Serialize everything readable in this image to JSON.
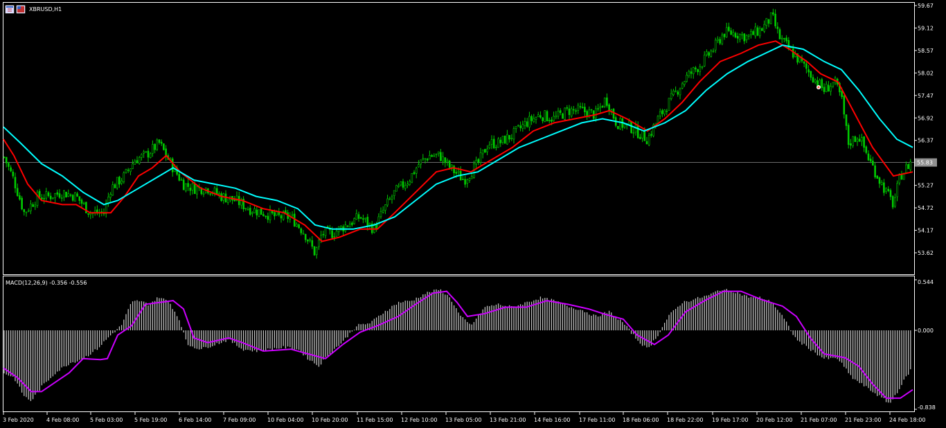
{
  "window": {
    "title": "XBRUSD,H1",
    "icon_names": [
      "chart-window-icon",
      "symbol-flag-icon"
    ]
  },
  "chart_data": [
    {
      "type": "candlestick",
      "symbol": "XBRUSD",
      "timeframe": "H1",
      "ylim": [
        53.3,
        59.7
      ],
      "y_ticks": [
        "59.67",
        "59.12",
        "58.57",
        "58.02",
        "57.47",
        "56.92",
        "56.37",
        "55.83",
        "55.27",
        "54.72",
        "54.17",
        "53.62"
      ],
      "current_price": "55.83",
      "x_ticks": [
        "3 Feb 2020",
        "4 Feb 08:00",
        "5 Feb 03:00",
        "5 Feb 19:00",
        "6 Feb 14:00",
        "7 Feb 09:00",
        "10 Feb 04:00",
        "10 Feb 20:00",
        "11 Feb 15:00",
        "12 Feb 10:00",
        "13 Feb 05:00",
        "13 Feb 21:00",
        "14 Feb 16:00",
        "17 Feb 11:00",
        "18 Feb 06:00",
        "18 Feb 22:00",
        "19 Feb 17:00",
        "20 Feb 12:00",
        "21 Feb 07:00",
        "21 Feb 23:00",
        "24 Feb 18:00"
      ],
      "close_path": [
        [
          0,
          56.2
        ],
        [
          20,
          55.4
        ],
        [
          35,
          54.6
        ],
        [
          55,
          55.0
        ],
        [
          70,
          55.0
        ],
        [
          90,
          55.1
        ],
        [
          110,
          55.0
        ],
        [
          130,
          54.6
        ],
        [
          150,
          54.6
        ],
        [
          160,
          55.2
        ],
        [
          180,
          55.5
        ],
        [
          195,
          55.9
        ],
        [
          210,
          56.0
        ],
        [
          230,
          56.3
        ],
        [
          250,
          55.7
        ],
        [
          265,
          55.3
        ],
        [
          280,
          55.2
        ],
        [
          300,
          55.2
        ],
        [
          320,
          55.0
        ],
        [
          340,
          54.9
        ],
        [
          360,
          54.7
        ],
        [
          380,
          54.6
        ],
        [
          400,
          54.5
        ],
        [
          420,
          54.5
        ],
        [
          440,
          54.1
        ],
        [
          455,
          53.6
        ],
        [
          465,
          54.1
        ],
        [
          480,
          54.1
        ],
        [
          500,
          54.3
        ],
        [
          520,
          54.5
        ],
        [
          540,
          54.2
        ],
        [
          555,
          54.7
        ],
        [
          570,
          55.1
        ],
        [
          590,
          55.4
        ],
        [
          605,
          55.8
        ],
        [
          620,
          56.0
        ],
        [
          635,
          56.0
        ],
        [
          650,
          55.7
        ],
        [
          670,
          55.4
        ],
        [
          690,
          55.8
        ],
        [
          705,
          56.3
        ],
        [
          720,
          56.3
        ],
        [
          740,
          56.5
        ],
        [
          760,
          56.8
        ],
        [
          780,
          57.0
        ],
        [
          800,
          56.9
        ],
        [
          820,
          57.1
        ],
        [
          840,
          57.1
        ],
        [
          860,
          57.0
        ],
        [
          875,
          57.4
        ],
        [
          890,
          56.8
        ],
        [
          910,
          56.7
        ],
        [
          935,
          56.4
        ],
        [
          950,
          56.9
        ],
        [
          970,
          57.4
        ],
        [
          990,
          57.9
        ],
        [
          1010,
          58.2
        ],
        [
          1030,
          58.6
        ],
        [
          1045,
          59.0
        ],
        [
          1060,
          59.0
        ],
        [
          1080,
          58.9
        ],
        [
          1100,
          59.1
        ],
        [
          1115,
          59.4
        ],
        [
          1125,
          58.9
        ],
        [
          1140,
          58.6
        ],
        [
          1160,
          58.2
        ],
        [
          1175,
          57.9
        ],
        [
          1190,
          57.6
        ],
        [
          1205,
          57.8
        ],
        [
          1215,
          57.4
        ],
        [
          1225,
          56.3
        ],
        [
          1240,
          56.5
        ],
        [
          1255,
          55.9
        ],
        [
          1270,
          55.4
        ],
        [
          1290,
          54.8
        ],
        [
          1300,
          55.5
        ],
        [
          1318,
          55.9
        ]
      ],
      "series": [
        {
          "name": "Red MA",
          "color": "#ff0000",
          "points": [
            [
              5,
              56.4
            ],
            [
              20,
              56.0
            ],
            [
              40,
              55.3
            ],
            [
              60,
              54.9
            ],
            [
              90,
              54.8
            ],
            [
              110,
              54.8
            ],
            [
              130,
              54.6
            ],
            [
              160,
              54.6
            ],
            [
              180,
              55.0
            ],
            [
              200,
              55.5
            ],
            [
              220,
              55.7
            ],
            [
              240,
              56.0
            ],
            [
              260,
              55.6
            ],
            [
              290,
              55.2
            ],
            [
              320,
              55.0
            ],
            [
              350,
              54.9
            ],
            [
              380,
              54.7
            ],
            [
              410,
              54.6
            ],
            [
              440,
              54.3
            ],
            [
              465,
              53.9
            ],
            [
              490,
              54.0
            ],
            [
              520,
              54.2
            ],
            [
              545,
              54.2
            ],
            [
              570,
              54.6
            ],
            [
              600,
              55.1
            ],
            [
              630,
              55.6
            ],
            [
              655,
              55.7
            ],
            [
              680,
              55.6
            ],
            [
              710,
              55.9
            ],
            [
              740,
              56.2
            ],
            [
              770,
              56.6
            ],
            [
              800,
              56.8
            ],
            [
              830,
              56.9
            ],
            [
              860,
              57.0
            ],
            [
              880,
              57.1
            ],
            [
              905,
              56.9
            ],
            [
              935,
              56.6
            ],
            [
              960,
              56.9
            ],
            [
              985,
              57.3
            ],
            [
              1010,
              57.8
            ],
            [
              1040,
              58.3
            ],
            [
              1070,
              58.5
            ],
            [
              1095,
              58.7
            ],
            [
              1120,
              58.8
            ],
            [
              1140,
              58.6
            ],
            [
              1165,
              58.3
            ],
            [
              1185,
              58.0
            ],
            [
              1210,
              57.8
            ],
            [
              1235,
              57.0
            ],
            [
              1260,
              56.2
            ],
            [
              1290,
              55.5
            ],
            [
              1318,
              55.6
            ]
          ]
        },
        {
          "name": "Cyan MA",
          "color": "#00ffff",
          "points": [
            [
              5,
              56.7
            ],
            [
              30,
              56.3
            ],
            [
              60,
              55.8
            ],
            [
              90,
              55.5
            ],
            [
              120,
              55.1
            ],
            [
              150,
              54.8
            ],
            [
              170,
              54.9
            ],
            [
              200,
              55.2
            ],
            [
              230,
              55.5
            ],
            [
              250,
              55.7
            ],
            [
              280,
              55.4
            ],
            [
              310,
              55.3
            ],
            [
              340,
              55.2
            ],
            [
              370,
              55.0
            ],
            [
              400,
              54.9
            ],
            [
              430,
              54.7
            ],
            [
              455,
              54.3
            ],
            [
              480,
              54.2
            ],
            [
              510,
              54.2
            ],
            [
              540,
              54.3
            ],
            [
              570,
              54.5
            ],
            [
              600,
              54.9
            ],
            [
              630,
              55.3
            ],
            [
              660,
              55.5
            ],
            [
              690,
              55.6
            ],
            [
              720,
              55.9
            ],
            [
              750,
              56.2
            ],
            [
              780,
              56.4
            ],
            [
              810,
              56.6
            ],
            [
              840,
              56.8
            ],
            [
              870,
              56.9
            ],
            [
              900,
              56.8
            ],
            [
              930,
              56.6
            ],
            [
              960,
              56.8
            ],
            [
              990,
              57.1
            ],
            [
              1020,
              57.6
            ],
            [
              1050,
              58.0
            ],
            [
              1080,
              58.3
            ],
            [
              1105,
              58.5
            ],
            [
              1130,
              58.7
            ],
            [
              1160,
              58.6
            ],
            [
              1190,
              58.3
            ],
            [
              1215,
              58.1
            ],
            [
              1240,
              57.6
            ],
            [
              1270,
              56.9
            ],
            [
              1295,
              56.4
            ],
            [
              1318,
              56.2
            ]
          ]
        }
      ]
    },
    {
      "type": "histogram",
      "title": "MACD(12,26,9) -0.356 -0.556",
      "ylim": [
        -0.838,
        0.544
      ],
      "y_ticks": [
        "0.544",
        "0.000",
        "-0.838"
      ],
      "histogram_path": [
        [
          5,
          -0.45
        ],
        [
          20,
          -0.5
        ],
        [
          35,
          -0.7
        ],
        [
          45,
          -0.75
        ],
        [
          60,
          -0.6
        ],
        [
          80,
          -0.45
        ],
        [
          100,
          -0.35
        ],
        [
          120,
          -0.3
        ],
        [
          140,
          -0.2
        ],
        [
          160,
          -0.05
        ],
        [
          175,
          0.05
        ],
        [
          190,
          0.3
        ],
        [
          200,
          0.32
        ],
        [
          215,
          0.28
        ],
        [
          230,
          0.36
        ],
        [
          245,
          0.3
        ],
        [
          260,
          0.1
        ],
        [
          270,
          -0.15
        ],
        [
          290,
          -0.2
        ],
        [
          310,
          -0.15
        ],
        [
          330,
          -0.1
        ],
        [
          350,
          -0.2
        ],
        [
          370,
          -0.22
        ],
        [
          390,
          -0.2
        ],
        [
          410,
          -0.18
        ],
        [
          430,
          -0.2
        ],
        [
          445,
          -0.3
        ],
        [
          460,
          -0.38
        ],
        [
          475,
          -0.25
        ],
        [
          495,
          -0.12
        ],
        [
          515,
          0.05
        ],
        [
          535,
          0.08
        ],
        [
          555,
          0.2
        ],
        [
          575,
          0.3
        ],
        [
          595,
          0.32
        ],
        [
          615,
          0.4
        ],
        [
          635,
          0.44
        ],
        [
          650,
          0.35
        ],
        [
          665,
          0.15
        ],
        [
          680,
          0.05
        ],
        [
          700,
          0.25
        ],
        [
          720,
          0.28
        ],
        [
          740,
          0.25
        ],
        [
          760,
          0.3
        ],
        [
          780,
          0.35
        ],
        [
          800,
          0.32
        ],
        [
          820,
          0.26
        ],
        [
          840,
          0.22
        ],
        [
          860,
          0.15
        ],
        [
          880,
          0.2
        ],
        [
          900,
          0.08
        ],
        [
          920,
          -0.1
        ],
        [
          935,
          -0.2
        ],
        [
          950,
          -0.05
        ],
        [
          965,
          0.15
        ],
        [
          985,
          0.3
        ],
        [
          1005,
          0.34
        ],
        [
          1025,
          0.38
        ],
        [
          1040,
          0.44
        ],
        [
          1060,
          0.42
        ],
        [
          1080,
          0.36
        ],
        [
          1100,
          0.35
        ],
        [
          1115,
          0.3
        ],
        [
          1130,
          0.15
        ],
        [
          1150,
          -0.1
        ],
        [
          1170,
          -0.2
        ],
        [
          1190,
          -0.3
        ],
        [
          1210,
          -0.3
        ],
        [
          1230,
          -0.5
        ],
        [
          1250,
          -0.6
        ],
        [
          1270,
          -0.7
        ],
        [
          1285,
          -0.78
        ],
        [
          1300,
          -0.6
        ],
        [
          1318,
          -0.38
        ]
      ],
      "signal_color": "#cc00ff",
      "signal_path": [
        [
          5,
          -0.4
        ],
        [
          25,
          -0.5
        ],
        [
          45,
          -0.65
        ],
        [
          60,
          -0.65
        ],
        [
          80,
          -0.55
        ],
        [
          100,
          -0.45
        ],
        [
          120,
          -0.3
        ],
        [
          145,
          -0.31
        ],
        [
          155,
          -0.3
        ],
        [
          170,
          -0.05
        ],
        [
          190,
          0.05
        ],
        [
          210,
          0.28
        ],
        [
          250,
          0.32
        ],
        [
          265,
          0.23
        ],
        [
          280,
          -0.08
        ],
        [
          300,
          -0.13
        ],
        [
          330,
          -0.08
        ],
        [
          350,
          -0.13
        ],
        [
          380,
          -0.22
        ],
        [
          420,
          -0.2
        ],
        [
          445,
          -0.25
        ],
        [
          470,
          -0.3
        ],
        [
          495,
          -0.15
        ],
        [
          520,
          -0.02
        ],
        [
          545,
          0.05
        ],
        [
          575,
          0.15
        ],
        [
          600,
          0.28
        ],
        [
          625,
          0.4
        ],
        [
          645,
          0.42
        ],
        [
          660,
          0.3
        ],
        [
          675,
          0.15
        ],
        [
          700,
          0.18
        ],
        [
          730,
          0.25
        ],
        [
          760,
          0.25
        ],
        [
          790,
          0.32
        ],
        [
          820,
          0.28
        ],
        [
          850,
          0.23
        ],
        [
          875,
          0.17
        ],
        [
          900,
          0.12
        ],
        [
          920,
          -0.05
        ],
        [
          945,
          -0.15
        ],
        [
          965,
          -0.05
        ],
        [
          990,
          0.2
        ],
        [
          1020,
          0.33
        ],
        [
          1045,
          0.42
        ],
        [
          1070,
          0.42
        ],
        [
          1100,
          0.33
        ],
        [
          1130,
          0.26
        ],
        [
          1150,
          0.15
        ],
        [
          1170,
          -0.08
        ],
        [
          1190,
          -0.25
        ],
        [
          1220,
          -0.29
        ],
        [
          1240,
          -0.38
        ],
        [
          1260,
          -0.57
        ],
        [
          1280,
          -0.72
        ],
        [
          1300,
          -0.72
        ],
        [
          1318,
          -0.63
        ]
      ]
    }
  ]
}
